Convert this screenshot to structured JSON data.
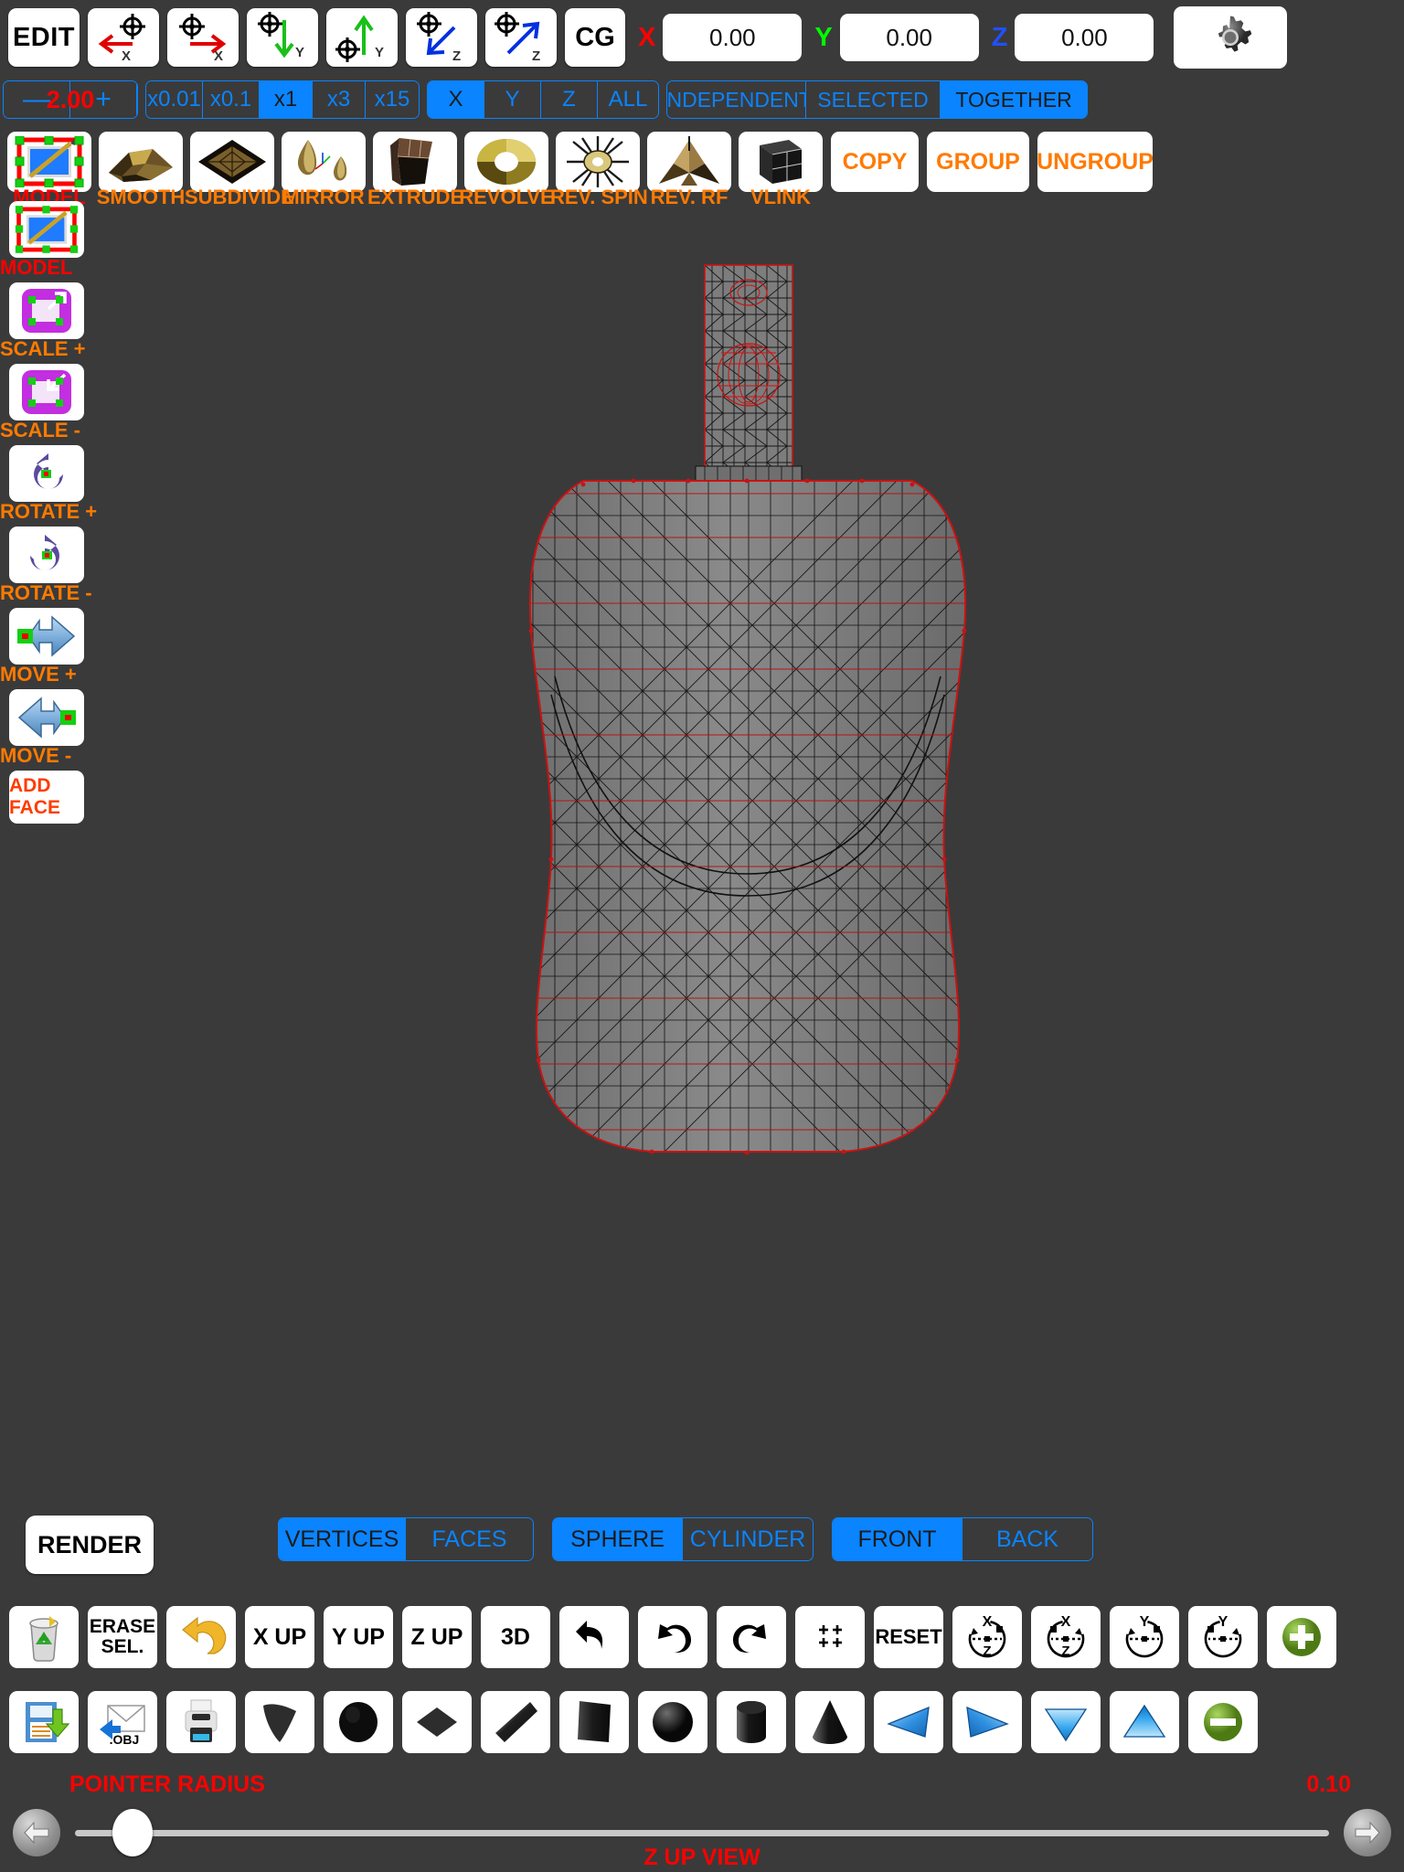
{
  "app": {
    "status_text": "Z UP VIEW"
  },
  "top_toolbar": {
    "edit_label": "EDIT",
    "cg_label": "CG",
    "axis_buttons": [
      {
        "name": "move-minus-x",
        "label": "X",
        "color": "#e00000",
        "dir": "left"
      },
      {
        "name": "move-plus-x",
        "label": "X",
        "color": "#e00000",
        "dir": "right"
      },
      {
        "name": "move-minus-y",
        "label": "Y",
        "color": "#18c018",
        "dir": "down"
      },
      {
        "name": "move-plus-y",
        "label": "Y",
        "color": "#18c018",
        "dir": "up"
      },
      {
        "name": "move-minus-z",
        "label": "Z",
        "color": "#0030e0",
        "dir": "downleft"
      },
      {
        "name": "move-plus-z",
        "label": "Z",
        "color": "#0030e0",
        "dir": "upright"
      }
    ],
    "coords": [
      {
        "axis": "X",
        "color": "#ff0000",
        "value": "0.00"
      },
      {
        "axis": "Y",
        "color": "#00ff00",
        "value": "0.00"
      },
      {
        "axis": "Z",
        "color": "#2050ff",
        "value": "0.00"
      }
    ],
    "settings_icon": "gear-icon"
  },
  "options_bar": {
    "step_value": "2.00",
    "minus_label": "—",
    "plus_label": "+",
    "multipliers": [
      {
        "label": "x0.01",
        "selected": false
      },
      {
        "label": "x0.1",
        "selected": false
      },
      {
        "label": "x1",
        "selected": true
      },
      {
        "label": "x3",
        "selected": false
      },
      {
        "label": "x15",
        "selected": false
      }
    ],
    "axes": [
      {
        "label": "X",
        "selected": true
      },
      {
        "label": "Y",
        "selected": false
      },
      {
        "label": "Z",
        "selected": false
      },
      {
        "label": "ALL",
        "selected": false
      }
    ],
    "modes": [
      {
        "label": "INDEPENDENT",
        "selected": false
      },
      {
        "label": "SELECTED",
        "selected": false
      },
      {
        "label": "TOGETHER",
        "selected": true
      }
    ]
  },
  "tools": [
    {
      "label": "MODEL",
      "icon": "model-edit-icon",
      "caption_color": "#ff0000",
      "selected": true
    },
    {
      "label": "SMOOTH",
      "icon": "smooth-mesh-icon"
    },
    {
      "label": "SUBDIVIDE",
      "icon": "subdivide-mesh-icon"
    },
    {
      "label": "MIRROR",
      "icon": "mirror-icon"
    },
    {
      "label": "EXTRUDE",
      "icon": "extrude-icon"
    },
    {
      "label": "REVOLVE",
      "icon": "revolve-icon"
    },
    {
      "label": "REV. SPIN",
      "icon": "revolve-spin-icon"
    },
    {
      "label": "REV. RF",
      "icon": "revolve-rf-icon"
    },
    {
      "label": "VLINK",
      "icon": "vlink-icon"
    }
  ],
  "tool_text_buttons": [
    {
      "label": "COPY",
      "name": "copy-button"
    },
    {
      "label": "GROUP",
      "name": "group-button"
    },
    {
      "label": "UNGROUP",
      "name": "ungroup-button"
    }
  ],
  "sidebar": {
    "items": [
      {
        "label": "MODEL",
        "icon": "model-edit-icon",
        "color": "#ff0000"
      },
      {
        "label": "SCALE +",
        "icon": "scale-up-icon",
        "color": "#ff7a00"
      },
      {
        "label": "SCALE -",
        "icon": "scale-down-icon",
        "color": "#ff7a00"
      },
      {
        "label": "ROTATE +",
        "icon": "rotate-ccw-icon",
        "color": "#ff7a00"
      },
      {
        "label": "ROTATE -",
        "icon": "rotate-cw-icon",
        "color": "#ff7a00"
      },
      {
        "label": "MOVE +",
        "icon": "arrow-right-icon",
        "color": "#ff7a00"
      },
      {
        "label": "MOVE -",
        "icon": "arrow-left-icon",
        "color": "#ff7a00"
      }
    ],
    "add_face_label": "ADD FACE"
  },
  "bottom_bar": {
    "render_label": "RENDER",
    "vertices_faces": [
      {
        "label": "VERTICES",
        "selected": true
      },
      {
        "label": "FACES",
        "selected": false
      }
    ],
    "sphere_cylinder": [
      {
        "label": "SPHERE",
        "selected": true
      },
      {
        "label": "CYLINDER",
        "selected": false
      }
    ],
    "front_back": [
      {
        "label": "FRONT",
        "selected": true
      },
      {
        "label": "BACK",
        "selected": false
      }
    ]
  },
  "icon_row_1": [
    {
      "name": "trash-recycle-icon",
      "label": ""
    },
    {
      "name": "erase-selection-button",
      "label": "ERASE\nSEL."
    },
    {
      "name": "undo-gold-icon",
      "label": ""
    },
    {
      "name": "x-up-button",
      "label": "X UP"
    },
    {
      "name": "y-up-button",
      "label": "Y UP"
    },
    {
      "name": "z-up-button",
      "label": "Z UP"
    },
    {
      "name": "view-3d-button",
      "label": "3D"
    },
    {
      "name": "undo-icon",
      "label": ""
    },
    {
      "name": "undo-arrow-icon",
      "label": ""
    },
    {
      "name": "redo-arrow-icon",
      "label": ""
    },
    {
      "name": "four-points-icon",
      "label": ""
    },
    {
      "name": "reset-button",
      "label": "RESET"
    },
    {
      "name": "rotate-xz-ccw-icon",
      "label": ""
    },
    {
      "name": "rotate-xz-cw-icon",
      "label": ""
    },
    {
      "name": "rotate-y-ccw-icon",
      "label": ""
    },
    {
      "name": "rotate-y-cw-icon",
      "label": ""
    },
    {
      "name": "zoom-in-icon",
      "label": ""
    }
  ],
  "icon_row_2": [
    {
      "name": "save-file-icon",
      "label": ""
    },
    {
      "name": "import-obj-icon",
      "label": ".OBJ"
    },
    {
      "name": "print-icon",
      "label": ""
    },
    {
      "name": "shape-curved-plane-icon",
      "label": ""
    },
    {
      "name": "shape-sphere-icon",
      "label": ""
    },
    {
      "name": "shape-diamond-icon",
      "label": ""
    },
    {
      "name": "shape-slab-icon",
      "label": ""
    },
    {
      "name": "shape-box-icon",
      "label": ""
    },
    {
      "name": "shape-hemisphere-icon",
      "label": ""
    },
    {
      "name": "shape-cylinder-icon",
      "label": ""
    },
    {
      "name": "shape-cone-icon",
      "label": ""
    },
    {
      "name": "shape-tri-left-icon",
      "label": ""
    },
    {
      "name": "shape-tri-right-icon",
      "label": ""
    },
    {
      "name": "shape-tri-down-icon",
      "label": ""
    },
    {
      "name": "shape-tri-up-icon",
      "label": ""
    },
    {
      "name": "zoom-out-icon",
      "label": ""
    }
  ],
  "footer": {
    "pointer_radius_label": "POINTER RADIUS",
    "pointer_radius_value": "0.10",
    "slider_percent": 3,
    "prev_icon": "arrow-left-icon",
    "next_icon": "arrow-right-icon"
  },
  "colors": {
    "accent_blue": "#0a84ff",
    "background": "#3a3a3a",
    "orange": "#ff7a00",
    "red": "#ff0000"
  }
}
